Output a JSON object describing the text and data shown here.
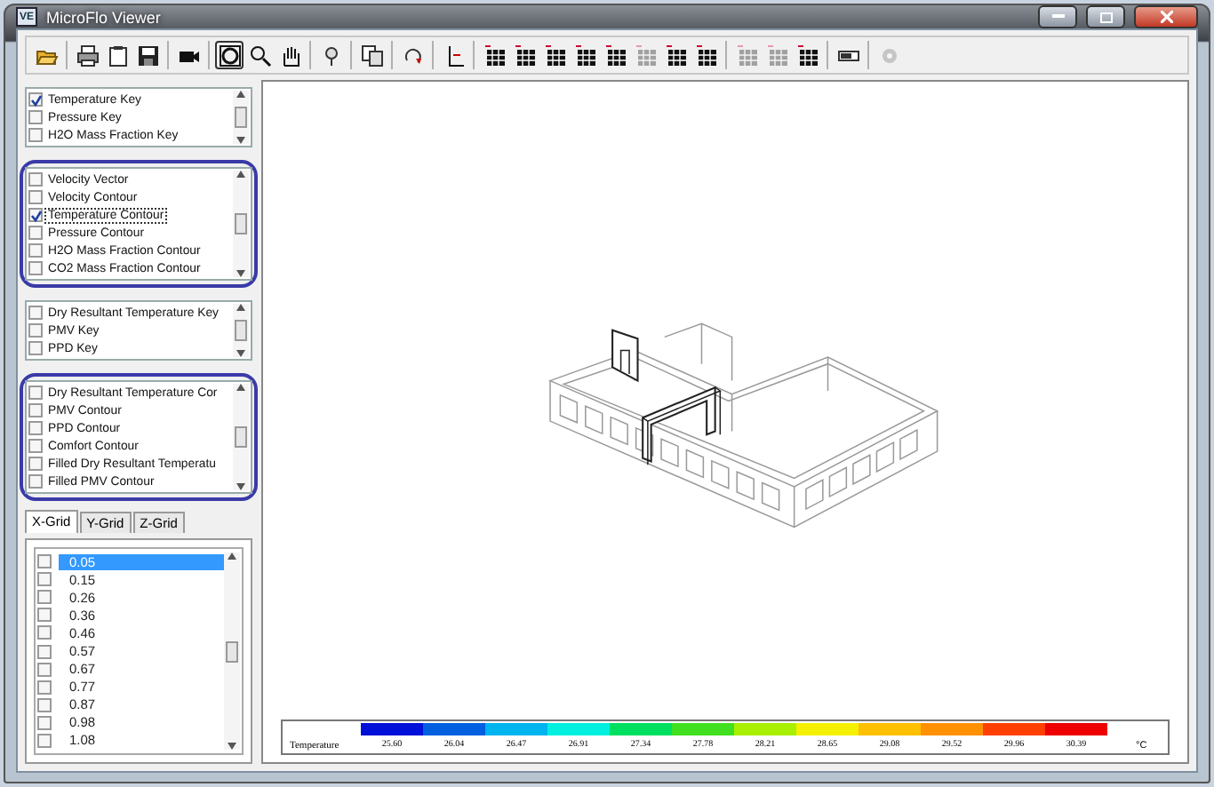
{
  "window": {
    "app_icon": "VE",
    "title": "MicroFlo Viewer"
  },
  "toolbar": [
    {
      "kind": "open",
      "disabled": false,
      "pressed": false
    },
    {
      "kind": "separator"
    },
    {
      "kind": "print",
      "disabled": false,
      "pressed": false
    },
    {
      "kind": "clipboard",
      "disabled": false,
      "pressed": false
    },
    {
      "kind": "save",
      "disabled": false,
      "pressed": false
    },
    {
      "kind": "separator"
    },
    {
      "kind": "camera",
      "disabled": false,
      "pressed": false
    },
    {
      "kind": "separator"
    },
    {
      "kind": "fit",
      "disabled": false,
      "pressed": true
    },
    {
      "kind": "zoom",
      "disabled": false,
      "pressed": false
    },
    {
      "kind": "hand",
      "disabled": false,
      "pressed": false
    },
    {
      "kind": "separator"
    },
    {
      "kind": "pin",
      "disabled": false,
      "pressed": false
    },
    {
      "kind": "separator"
    },
    {
      "kind": "copy",
      "disabled": false,
      "pressed": false
    },
    {
      "kind": "separator"
    },
    {
      "kind": "rotate",
      "disabled": false,
      "pressed": false
    },
    {
      "kind": "separator"
    },
    {
      "kind": "axis",
      "disabled": false,
      "pressed": false
    },
    {
      "kind": "separator"
    },
    {
      "kind": "grid",
      "disabled": false,
      "pressed": false
    },
    {
      "kind": "grid",
      "disabled": false,
      "pressed": false
    },
    {
      "kind": "grid",
      "disabled": false,
      "pressed": false
    },
    {
      "kind": "grid",
      "disabled": false,
      "pressed": false
    },
    {
      "kind": "grid",
      "disabled": false,
      "pressed": false
    },
    {
      "kind": "grid",
      "disabled": true,
      "pressed": false
    },
    {
      "kind": "grid",
      "disabled": false,
      "pressed": false
    },
    {
      "kind": "grid",
      "disabled": false,
      "pressed": false
    },
    {
      "kind": "separator"
    },
    {
      "kind": "grid",
      "disabled": true,
      "pressed": false
    },
    {
      "kind": "grid",
      "disabled": true,
      "pressed": false
    },
    {
      "kind": "grid",
      "disabled": false,
      "pressed": false
    },
    {
      "kind": "separator"
    },
    {
      "kind": "legend",
      "disabled": false,
      "pressed": false
    },
    {
      "kind": "separator"
    },
    {
      "kind": "gear",
      "disabled": true,
      "pressed": false
    }
  ],
  "layer_lists": [
    {
      "highlighted": false,
      "items": [
        {
          "label": "Temperature Key",
          "checked": true
        },
        {
          "label": "Pressure Key",
          "checked": false
        },
        {
          "label": "H2O Mass Fraction Key",
          "checked": false
        }
      ]
    },
    {
      "highlighted": true,
      "items": [
        {
          "label": "Velocity Vector",
          "checked": false
        },
        {
          "label": "Velocity Contour",
          "checked": false
        },
        {
          "label": "Temperature Contour",
          "checked": true
        },
        {
          "label": "Pressure Contour",
          "checked": false
        },
        {
          "label": "H2O Mass Fraction Contour",
          "checked": false
        },
        {
          "label": "CO2 Mass Fraction Contour",
          "checked": false
        }
      ]
    },
    {
      "highlighted": false,
      "items": [
        {
          "label": "Dry Resultant Temperature Key",
          "checked": false
        },
        {
          "label": "PMV Key",
          "checked": false
        },
        {
          "label": "PPD Key",
          "checked": false
        }
      ]
    },
    {
      "highlighted": true,
      "items": [
        {
          "label": "Dry Resultant Temperature Cor",
          "checked": false
        },
        {
          "label": "PMV Contour",
          "checked": false
        },
        {
          "label": "PPD Contour",
          "checked": false
        },
        {
          "label": "Comfort Contour",
          "checked": false
        },
        {
          "label": "Filled Dry Resultant Temperatu",
          "checked": false
        },
        {
          "label": "Filled PMV Contour",
          "checked": false
        }
      ]
    }
  ],
  "grid_tabs": [
    {
      "label": "X-Grid",
      "selected": true
    },
    {
      "label": "Y-Grid",
      "selected": false
    },
    {
      "label": "Z-Grid",
      "selected": false
    }
  ],
  "grid_values": [
    {
      "label": "0.05",
      "checked": false,
      "selected": true
    },
    {
      "label": "0.15",
      "checked": false,
      "selected": false
    },
    {
      "label": "0.26",
      "checked": false,
      "selected": false
    },
    {
      "label": "0.36",
      "checked": false,
      "selected": false
    },
    {
      "label": "0.46",
      "checked": false,
      "selected": false
    },
    {
      "label": "0.57",
      "checked": false,
      "selected": false
    },
    {
      "label": "0.67",
      "checked": false,
      "selected": false
    },
    {
      "label": "0.77",
      "checked": false,
      "selected": false
    },
    {
      "label": "0.87",
      "checked": false,
      "selected": false
    },
    {
      "label": "0.98",
      "checked": false,
      "selected": false
    },
    {
      "label": "1.08",
      "checked": false,
      "selected": false
    }
  ],
  "legend": {
    "title": "Temperature",
    "unit": "°C",
    "entries": [
      {
        "value": "25.60",
        "color": "#0010d8"
      },
      {
        "value": "26.04",
        "color": "#0060e0"
      },
      {
        "value": "26.47",
        "color": "#00b4f0"
      },
      {
        "value": "26.91",
        "color": "#00f0e0"
      },
      {
        "value": "27.34",
        "color": "#00e060"
      },
      {
        "value": "27.78",
        "color": "#40e020"
      },
      {
        "value": "28.21",
        "color": "#a8f000"
      },
      {
        "value": "28.65",
        "color": "#f4f000"
      },
      {
        "value": "29.08",
        "color": "#ffc000"
      },
      {
        "value": "29.52",
        "color": "#ff9000"
      },
      {
        "value": "29.96",
        "color": "#ff4000"
      },
      {
        "value": "30.39",
        "color": "#ee0000"
      }
    ]
  }
}
